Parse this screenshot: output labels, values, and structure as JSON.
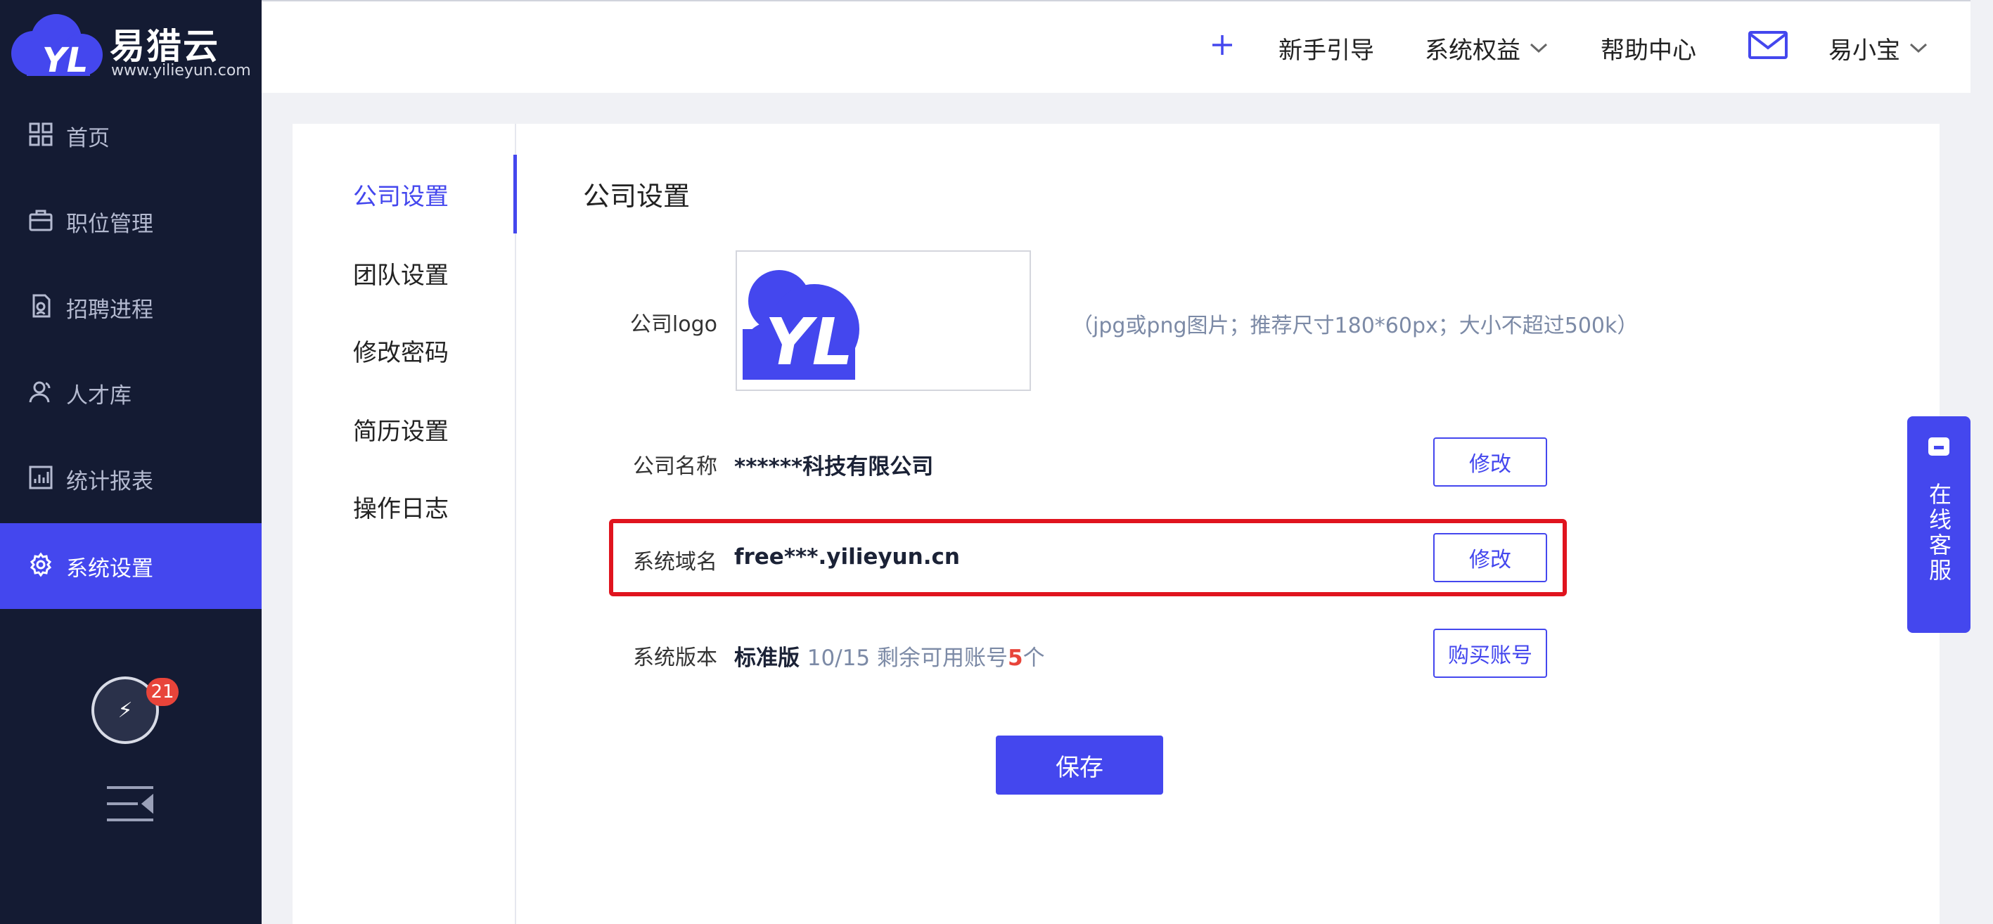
{
  "brand": {
    "name": "易猎云",
    "url": "www.yilieyun.com",
    "mark": "YL"
  },
  "sidebar": {
    "items": [
      {
        "label": "首页",
        "icon": "grid-icon"
      },
      {
        "label": "职位管理",
        "icon": "briefcase-icon"
      },
      {
        "label": "招聘进程",
        "icon": "process-icon"
      },
      {
        "label": "人才库",
        "icon": "users-icon"
      },
      {
        "label": "统计报表",
        "icon": "chart-icon"
      },
      {
        "label": "系统设置",
        "icon": "gear-icon"
      }
    ],
    "active_index": 5,
    "badge_count": "21"
  },
  "topbar": {
    "guide_label": "新手引导",
    "benefits_label": "系统权益",
    "help_label": "帮助中心",
    "user_name": "易小宝"
  },
  "subnav": {
    "items": [
      "公司设置",
      "团队设置",
      "修改密码",
      "简历设置",
      "操作日志"
    ],
    "active_index": 0
  },
  "main": {
    "title": "公司设置",
    "logo_label": "公司logo",
    "logo_hint": "（jpg或png图片；推荐尺寸180*60px；大小不超过500k）",
    "company_name_label": "公司名称",
    "company_name_value": "******科技有限公司",
    "edit_label": "修改",
    "domain_label": "系统域名",
    "domain_value": "free***.yilieyun.cn",
    "version_label": "系统版本",
    "version_value": "标准版",
    "version_accounts": "10/15 剩余可用账号",
    "version_remaining": "5",
    "version_unit": "个",
    "buy_label": "购买账号",
    "save_label": "保存"
  },
  "service": {
    "label": "在线客服"
  },
  "colors": {
    "accent": "#4447ee",
    "sidebar_bg": "#141b33",
    "highlight": "#e0141e",
    "badge": "#e8443a"
  }
}
